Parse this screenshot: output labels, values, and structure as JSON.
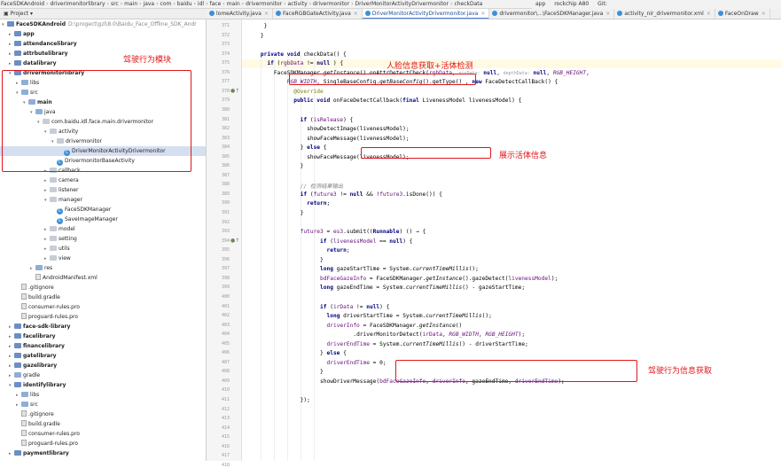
{
  "breadcrumb": [
    "FaceSDKAndroid",
    "driverimonitorlibrary",
    "src",
    "main",
    "java",
    "com",
    "baidu",
    "idl",
    "face",
    "main",
    "drivermonitor",
    "activity",
    "drivermonitor",
    "DriverMonitorActivityDrivermonitor",
    "checkData"
  ],
  "toolbar": {
    "run_config": "app",
    "device": "rockchip A80",
    "extra": "Git:"
  },
  "tabs": [
    {
      "label": "lomeActivity.java",
      "active": false
    },
    {
      "label": "FaceRGBGateActivity.java",
      "active": false
    },
    {
      "label": "DriverMonitorActivityDrivermonitor.java",
      "active": true
    },
    {
      "label": "drivermonitor\\...\\FaceSDKManager.java",
      "active": false
    },
    {
      "label": "activity_nir_drivermonitor.xml",
      "active": false
    },
    {
      "label": "FaceOnDraw",
      "active": false
    }
  ],
  "project_header": "Project",
  "tree": [
    {
      "label": "FaceSDKAndroid",
      "extra": "D:\\progect\\gzl\\8.0\\Baidu_Face_Offline_SDK_Andr",
      "depth": 0,
      "kind": "module",
      "bold": true,
      "arrow": "▾"
    },
    {
      "label": "app",
      "depth": 1,
      "kind": "module",
      "bold": true,
      "arrow": "▸"
    },
    {
      "label": "attendancelibrary",
      "depth": 1,
      "kind": "module",
      "bold": true,
      "arrow": "▸"
    },
    {
      "label": "attrbutelibrary",
      "depth": 1,
      "kind": "module",
      "bold": true,
      "arrow": "▸"
    },
    {
      "label": "datalibrary",
      "depth": 1,
      "kind": "module",
      "bold": true,
      "arrow": "▸"
    },
    {
      "label": "drivermonitorlibrary",
      "depth": 1,
      "kind": "module",
      "bold": true,
      "arrow": "▾"
    },
    {
      "label": "libs",
      "depth": 2,
      "kind": "folder",
      "arrow": "▸"
    },
    {
      "label": "src",
      "depth": 2,
      "kind": "folder",
      "arrow": "▾"
    },
    {
      "label": "main",
      "depth": 3,
      "kind": "folder",
      "bold": true,
      "arrow": "▾"
    },
    {
      "label": "java",
      "depth": 4,
      "kind": "folder",
      "arrow": "▾"
    },
    {
      "label": "com.baidu.idl.face.main.drivermonitor",
      "depth": 5,
      "kind": "pkg",
      "arrow": "▾"
    },
    {
      "label": "activity",
      "depth": 6,
      "kind": "pkg",
      "arrow": "▾"
    },
    {
      "label": "drivermonitor",
      "depth": 7,
      "kind": "pkg",
      "arrow": "▾"
    },
    {
      "label": "DriverMonitorActivityDrivermonitor",
      "depth": 8,
      "kind": "class",
      "selected": true,
      "arrow": ""
    },
    {
      "label": "DrivermonitorBaseActivity",
      "depth": 7,
      "kind": "class",
      "arrow": ""
    },
    {
      "label": "callback",
      "depth": 6,
      "kind": "pkg",
      "arrow": "▸"
    },
    {
      "label": "camera",
      "depth": 6,
      "kind": "pkg",
      "arrow": "▸"
    },
    {
      "label": "listener",
      "depth": 6,
      "kind": "pkg",
      "arrow": "▸"
    },
    {
      "label": "manager",
      "depth": 6,
      "kind": "pkg",
      "arrow": "▾"
    },
    {
      "label": "FaceSDKManager",
      "depth": 7,
      "kind": "class",
      "arrow": ""
    },
    {
      "label": "SaveImageManager",
      "depth": 7,
      "kind": "class",
      "arrow": ""
    },
    {
      "label": "model",
      "depth": 6,
      "kind": "pkg",
      "arrow": "▸"
    },
    {
      "label": "setting",
      "depth": 6,
      "kind": "pkg",
      "arrow": "▸"
    },
    {
      "label": "utils",
      "depth": 6,
      "kind": "pkg",
      "arrow": "▸"
    },
    {
      "label": "view",
      "depth": 6,
      "kind": "pkg",
      "arrow": "▸"
    },
    {
      "label": "res",
      "depth": 4,
      "kind": "folder",
      "arrow": "▸"
    },
    {
      "label": "AndroidManifest.xml",
      "depth": 4,
      "kind": "file",
      "arrow": ""
    },
    {
      "label": ".gitignore",
      "depth": 2,
      "kind": "file",
      "arrow": ""
    },
    {
      "label": "build.gradle",
      "depth": 2,
      "kind": "file",
      "arrow": ""
    },
    {
      "label": "consumer-rules.pro",
      "depth": 2,
      "kind": "file",
      "arrow": ""
    },
    {
      "label": "proguard-rules.pro",
      "depth": 2,
      "kind": "file",
      "arrow": ""
    },
    {
      "label": "face-sdk-library",
      "depth": 1,
      "kind": "module",
      "bold": true,
      "arrow": "▸"
    },
    {
      "label": "facelibrary",
      "depth": 1,
      "kind": "module",
      "bold": true,
      "arrow": "▸"
    },
    {
      "label": "financelibrary",
      "depth": 1,
      "kind": "module",
      "bold": true,
      "arrow": "▸"
    },
    {
      "label": "gatelibrary",
      "depth": 1,
      "kind": "module",
      "bold": true,
      "arrow": "▸"
    },
    {
      "label": "gazelibrary",
      "depth": 1,
      "kind": "module",
      "bold": true,
      "arrow": "▸"
    },
    {
      "label": "gradle",
      "depth": 1,
      "kind": "folder",
      "arrow": "▸"
    },
    {
      "label": "identifylibrary",
      "depth": 1,
      "kind": "module",
      "bold": true,
      "arrow": "▾"
    },
    {
      "label": "libs",
      "depth": 2,
      "kind": "folder",
      "arrow": "▸"
    },
    {
      "label": "src",
      "depth": 2,
      "kind": "folder",
      "arrow": "▸"
    },
    {
      "label": ".gitignore",
      "depth": 2,
      "kind": "file",
      "arrow": ""
    },
    {
      "label": "build.gradle",
      "depth": 2,
      "kind": "file",
      "arrow": ""
    },
    {
      "label": "consumer-rules.pro",
      "depth": 2,
      "kind": "file",
      "arrow": ""
    },
    {
      "label": "proguard-rules.pro",
      "depth": 2,
      "kind": "file",
      "arrow": ""
    },
    {
      "label": "paymentlibrary",
      "depth": 1,
      "kind": "module",
      "bold": true,
      "arrow": "▸"
    }
  ],
  "line_numbers": [
    "371",
    "372",
    "373",
    "374",
    "375",
    "376",
    "377",
    "378",
    "379",
    "380",
    "381",
    "382",
    "383",
    "384",
    "385",
    "386",
    "387",
    "388",
    "389",
    "390",
    "391",
    "392",
    "393",
    "394",
    "395",
    "396",
    "397",
    "398",
    "399",
    "400",
    "401",
    "402",
    "403",
    "404",
    "405",
    "406",
    "407",
    "408",
    "409",
    "410",
    "411",
    "412",
    "413",
    "414",
    "415",
    "416",
    "417",
    "418"
  ],
  "code_lines": [
    {
      "indent": 5,
      "text": "}"
    },
    {
      "indent": 4,
      "text": "}"
    },
    {
      "indent": 0,
      "text": ""
    },
    {
      "indent": 4,
      "html": "<span class=\"kw\">private void</span> checkData() {"
    },
    {
      "indent": 6,
      "html": "<span class=\"kw\">if</span> (<span class=\"fld\">rgbData</span> != <span class=\"kw\">null</span> ) {"
    },
    {
      "indent": 8,
      "html": "FaceSDKManager.<span class=\"st\">getInstance</span>().onAttrDetectCheck(<span class=\"fld\">rgbData</span>, <span class=\"hint\">nirData:</span> <span class=\"kw\">null</span>, <span class=\"hint\">depthData:</span> <span class=\"kw\">null</span>, <span class=\"fld st\">RGB_HEIGHT</span>,"
    },
    {
      "indent": 12,
      "html": "<span class=\"fld st\">RGB_WIDTH</span>, SingleBaseConfig.<span class=\"st\">getBaseConfig</span>().getType() , <span class=\"kw\">new</span> FaceDetectCallBack() {"
    },
    {
      "indent": 14,
      "html": "<span class=\"an\">@Override</span>"
    },
    {
      "indent": 14,
      "html": "<span class=\"kw\">public void</span> onFaceDetectCallback(<span class=\"kw\">final</span> LivenessModel livenessModel) {"
    },
    {
      "indent": 0,
      "text": ""
    },
    {
      "indent": 16,
      "html": "<span class=\"kw\">if</span> (<span class=\"fld\">isRelease</span>) {"
    },
    {
      "indent": 18,
      "html": "showDetectImage(livenessModel);"
    },
    {
      "indent": 18,
      "html": "showFaceMessage(livenessModel);"
    },
    {
      "indent": 16,
      "html": "} <span class=\"kw\">else</span> {"
    },
    {
      "indent": 18,
      "html": "showFaceMessage(livenessModel);"
    },
    {
      "indent": 16,
      "html": "}"
    },
    {
      "indent": 0,
      "text": ""
    },
    {
      "indent": 16,
      "html": "<span class=\"cm\">// 检测结果输出</span>"
    },
    {
      "indent": 16,
      "html": "<span class=\"kw\">if</span> (<span class=\"fld\">future3</span> != <span class=\"kw\">null</span> &amp;&amp; !<span class=\"fld\">future3</span>.isDone()) {"
    },
    {
      "indent": 18,
      "html": "<span class=\"kw\">return</span>;"
    },
    {
      "indent": 16,
      "html": "}"
    },
    {
      "indent": 0,
      "text": ""
    },
    {
      "indent": 16,
      "html": "<span class=\"fld\">future3</span> = <span class=\"fld\">es3</span>.submit((<span class=\"kw\">Runnable</span>) () → {"
    },
    {
      "indent": 22,
      "html": "<span class=\"kw\">if</span> (<span class=\"fld\">livenessModel</span> == <span class=\"kw\">null</span>) {"
    },
    {
      "indent": 24,
      "html": "<span class=\"kw\">return</span>;"
    },
    {
      "indent": 22,
      "html": "}"
    },
    {
      "indent": 22,
      "html": "<span class=\"kw\">long</span> gazeStartTime = System.<span class=\"st\">currentTimeMillis</span>();"
    },
    {
      "indent": 22,
      "html": "<span class=\"fld\">bdFaceGazeInfo</span> = FaceSDKManager.<span class=\"st\">getInstance</span>().gazeDetect(<span class=\"fld\">livenessModel</span>);"
    },
    {
      "indent": 22,
      "html": "<span class=\"kw\">long</span> gazeEndTime = System.<span class=\"st\">currentTimeMillis</span>() - gazeStartTime;"
    },
    {
      "indent": 0,
      "text": ""
    },
    {
      "indent": 22,
      "html": "<span class=\"kw\">if</span> (<span class=\"fld\">irData</span> != <span class=\"kw\">null</span>) {"
    },
    {
      "indent": 24,
      "html": "<span class=\"kw\">long</span> driverStartTime = System.<span class=\"st\">currentTimeMillis</span>();"
    },
    {
      "indent": 24,
      "html": "<span class=\"fld\">driverInfo</span> = FaceSDKManager.<span class=\"st\">getInstance</span>()"
    },
    {
      "indent": 32,
      "html": ".driverMonitorDetect(<span class=\"fld\">irData</span>, <span class=\"fld st\">RGB_WIDTH</span>, <span class=\"fld st\">RGB_HEIGHT</span>);"
    },
    {
      "indent": 24,
      "html": "<span class=\"fld\">driverEndTime</span> = System.<span class=\"st\">currentTimeMillis</span>() - driverStartTime;"
    },
    {
      "indent": 22,
      "html": "} <span class=\"kw\">else</span> {"
    },
    {
      "indent": 24,
      "html": "<span class=\"fld\">driverEndTime</span> = 0;"
    },
    {
      "indent": 22,
      "html": "}"
    },
    {
      "indent": 22,
      "html": "showDriverMessage(<span class=\"fld\">bdFaceGazeInfo</span>, <span class=\"fld\">driverInfo</span>, gazeEndTime, <span class=\"fld\">driverEndTime</span>);"
    },
    {
      "indent": 0,
      "text": ""
    },
    {
      "indent": 16,
      "html": "});"
    }
  ],
  "annotations": {
    "module_label": "驾驶行为模块",
    "face_info_label": "人脸信息获取+活体检测",
    "liveness_label": "展示活体信息",
    "driver_info_label": "驾驶行为信息获取",
    "accent_color": "#e0161b"
  }
}
